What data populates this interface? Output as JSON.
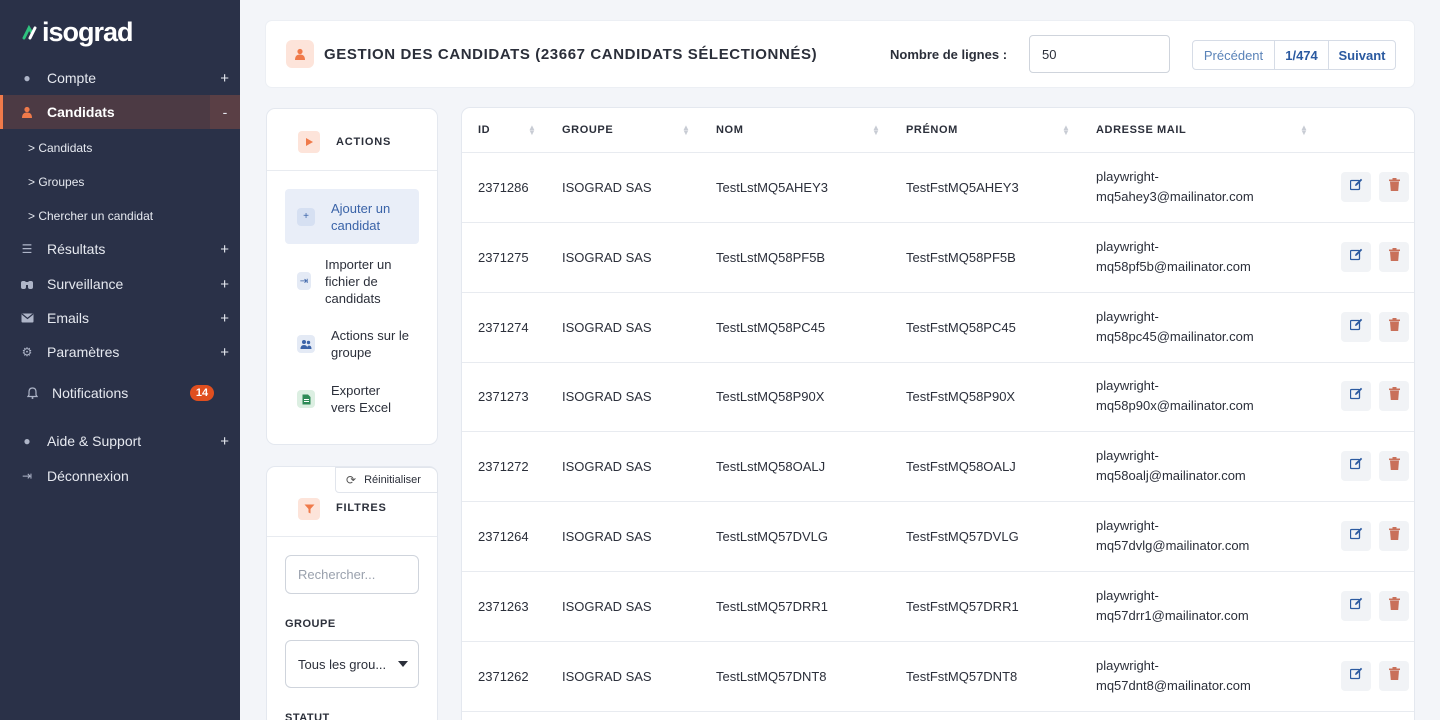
{
  "brand": {
    "name": "isograd"
  },
  "sidebar": {
    "items": [
      {
        "label": "Compte",
        "icon": "info-icon",
        "expand": "+"
      },
      {
        "label": "Candidats",
        "icon": "user-icon",
        "expand": "-"
      },
      {
        "label": "Résultats",
        "icon": "list-icon",
        "expand": "+"
      },
      {
        "label": "Surveillance",
        "icon": "binoculars-icon",
        "expand": "+"
      },
      {
        "label": "Emails",
        "icon": "envelope-icon",
        "expand": "+"
      },
      {
        "label": "Paramètres",
        "icon": "gear-icon",
        "expand": "+"
      },
      {
        "label": "Notifications",
        "icon": "bell-icon",
        "badge": "14"
      },
      {
        "label": "Aide & Support",
        "icon": "help-icon",
        "expand": "+"
      },
      {
        "label": "Déconnexion",
        "icon": "logout-icon"
      }
    ],
    "sub_items": [
      "> Candidats",
      "> Groupes",
      "> Chercher un candidat"
    ]
  },
  "header": {
    "title": "GESTION DES CANDIDATS (23667 CANDIDATS SÉLECTIONNÉS)",
    "rows_label": "Nombre de lignes :",
    "rows_value": "50",
    "pager": {
      "prev": "Précédent",
      "page": "1/474",
      "next": "Suivant"
    }
  },
  "actions": {
    "title": "ACTIONS",
    "items": [
      {
        "label": "Ajouter un candidat",
        "icon": "plus-icon"
      },
      {
        "label": "Importer un fichier de candidats",
        "icon": "import-icon"
      },
      {
        "label": "Actions sur le groupe",
        "icon": "group-icon"
      },
      {
        "label": "Exporter vers Excel",
        "icon": "excel-icon"
      }
    ]
  },
  "filters": {
    "title": "FILTRES",
    "reset": "Réinitialiser",
    "search_placeholder": "Rechercher...",
    "group_label": "GROUPE",
    "group_value": "Tous les grou...",
    "status_label": "STATUT"
  },
  "table": {
    "columns": [
      "ID",
      "GROUPE",
      "NOM",
      "PRÉNOM",
      "ADRESSE MAIL"
    ],
    "rows": [
      {
        "id": "2371286",
        "groupe": "ISOGRAD SAS",
        "nom": "TestLstMQ5AHEY3",
        "prenom": "TestFstMQ5AHEY3",
        "mail1": "playwright-",
        "mail2": "mq5ahey3@mailinator.com"
      },
      {
        "id": "2371275",
        "groupe": "ISOGRAD SAS",
        "nom": "TestLstMQ58PF5B",
        "prenom": "TestFstMQ58PF5B",
        "mail1": "playwright-",
        "mail2": "mq58pf5b@mailinator.com"
      },
      {
        "id": "2371274",
        "groupe": "ISOGRAD SAS",
        "nom": "TestLstMQ58PC45",
        "prenom": "TestFstMQ58PC45",
        "mail1": "playwright-",
        "mail2": "mq58pc45@mailinator.com"
      },
      {
        "id": "2371273",
        "groupe": "ISOGRAD SAS",
        "nom": "TestLstMQ58P90X",
        "prenom": "TestFstMQ58P90X",
        "mail1": "playwright-",
        "mail2": "mq58p90x@mailinator.com"
      },
      {
        "id": "2371272",
        "groupe": "ISOGRAD SAS",
        "nom": "TestLstMQ58OALJ",
        "prenom": "TestFstMQ58OALJ",
        "mail1": "playwright-",
        "mail2": "mq58oalj@mailinator.com"
      },
      {
        "id": "2371264",
        "groupe": "ISOGRAD SAS",
        "nom": "TestLstMQ57DVLG",
        "prenom": "TestFstMQ57DVLG",
        "mail1": "playwright-",
        "mail2": "mq57dvlg@mailinator.com"
      },
      {
        "id": "2371263",
        "groupe": "ISOGRAD SAS",
        "nom": "TestLstMQ57DRR1",
        "prenom": "TestFstMQ57DRR1",
        "mail1": "playwright-",
        "mail2": "mq57drr1@mailinator.com"
      },
      {
        "id": "2371262",
        "groupe": "ISOGRAD SAS",
        "nom": "TestLstMQ57DNT8",
        "prenom": "TestFstMQ57DNT8",
        "mail1": "playwright-",
        "mail2": "mq57dnt8@mailinator.com"
      }
    ]
  },
  "colors": {
    "sidebar_bg": "#2a3148",
    "accent": "#f07a4a",
    "badge": "#e04f1f",
    "link": "#2b5aa0"
  }
}
